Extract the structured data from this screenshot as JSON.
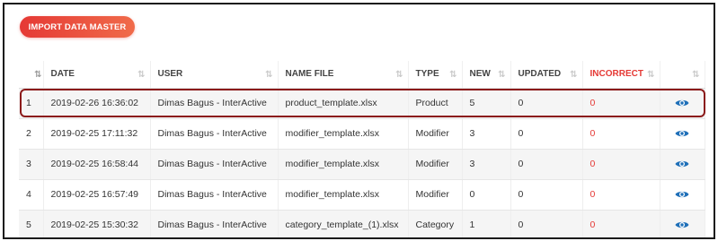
{
  "toolbar": {
    "import_label": "IMPORT DATA MASTER"
  },
  "table": {
    "columns": [
      "DATE",
      "USER",
      "NAME FILE",
      "TYPE",
      "NEW",
      "UPDATED",
      "INCORRECT"
    ],
    "rows": [
      {
        "no": "1",
        "date": "2019-02-26 16:36:02",
        "user": "Dimas Bagus - InterActive",
        "file": "product_template.xlsx",
        "type": "Product",
        "new": "5",
        "updated": "0",
        "incorrect": "0"
      },
      {
        "no": "2",
        "date": "2019-02-25 17:11:32",
        "user": "Dimas Bagus - InterActive",
        "file": "modifier_template.xlsx",
        "type": "Modifier",
        "new": "3",
        "updated": "0",
        "incorrect": "0"
      },
      {
        "no": "3",
        "date": "2019-02-25 16:58:44",
        "user": "Dimas Bagus - InterActive",
        "file": "modifier_template.xlsx",
        "type": "Modifier",
        "new": "3",
        "updated": "0",
        "incorrect": "0"
      },
      {
        "no": "4",
        "date": "2019-02-25 16:57:49",
        "user": "Dimas Bagus - InterActive",
        "file": "modifier_template.xlsx",
        "type": "Modifier",
        "new": "0",
        "updated": "0",
        "incorrect": "0"
      },
      {
        "no": "5",
        "date": "2019-02-25 15:30:32",
        "user": "Dimas Bagus - InterActive",
        "file": "category_template_(1).xlsx",
        "type": "Category",
        "new": "1",
        "updated": "0",
        "incorrect": "0"
      }
    ]
  },
  "colors": {
    "accent": "#e53935",
    "highlight_border": "#8b1a1a",
    "eye_icon": "#1e6fb8"
  },
  "icons": {
    "row_action": "eye-icon",
    "sort": "sort-icon"
  }
}
